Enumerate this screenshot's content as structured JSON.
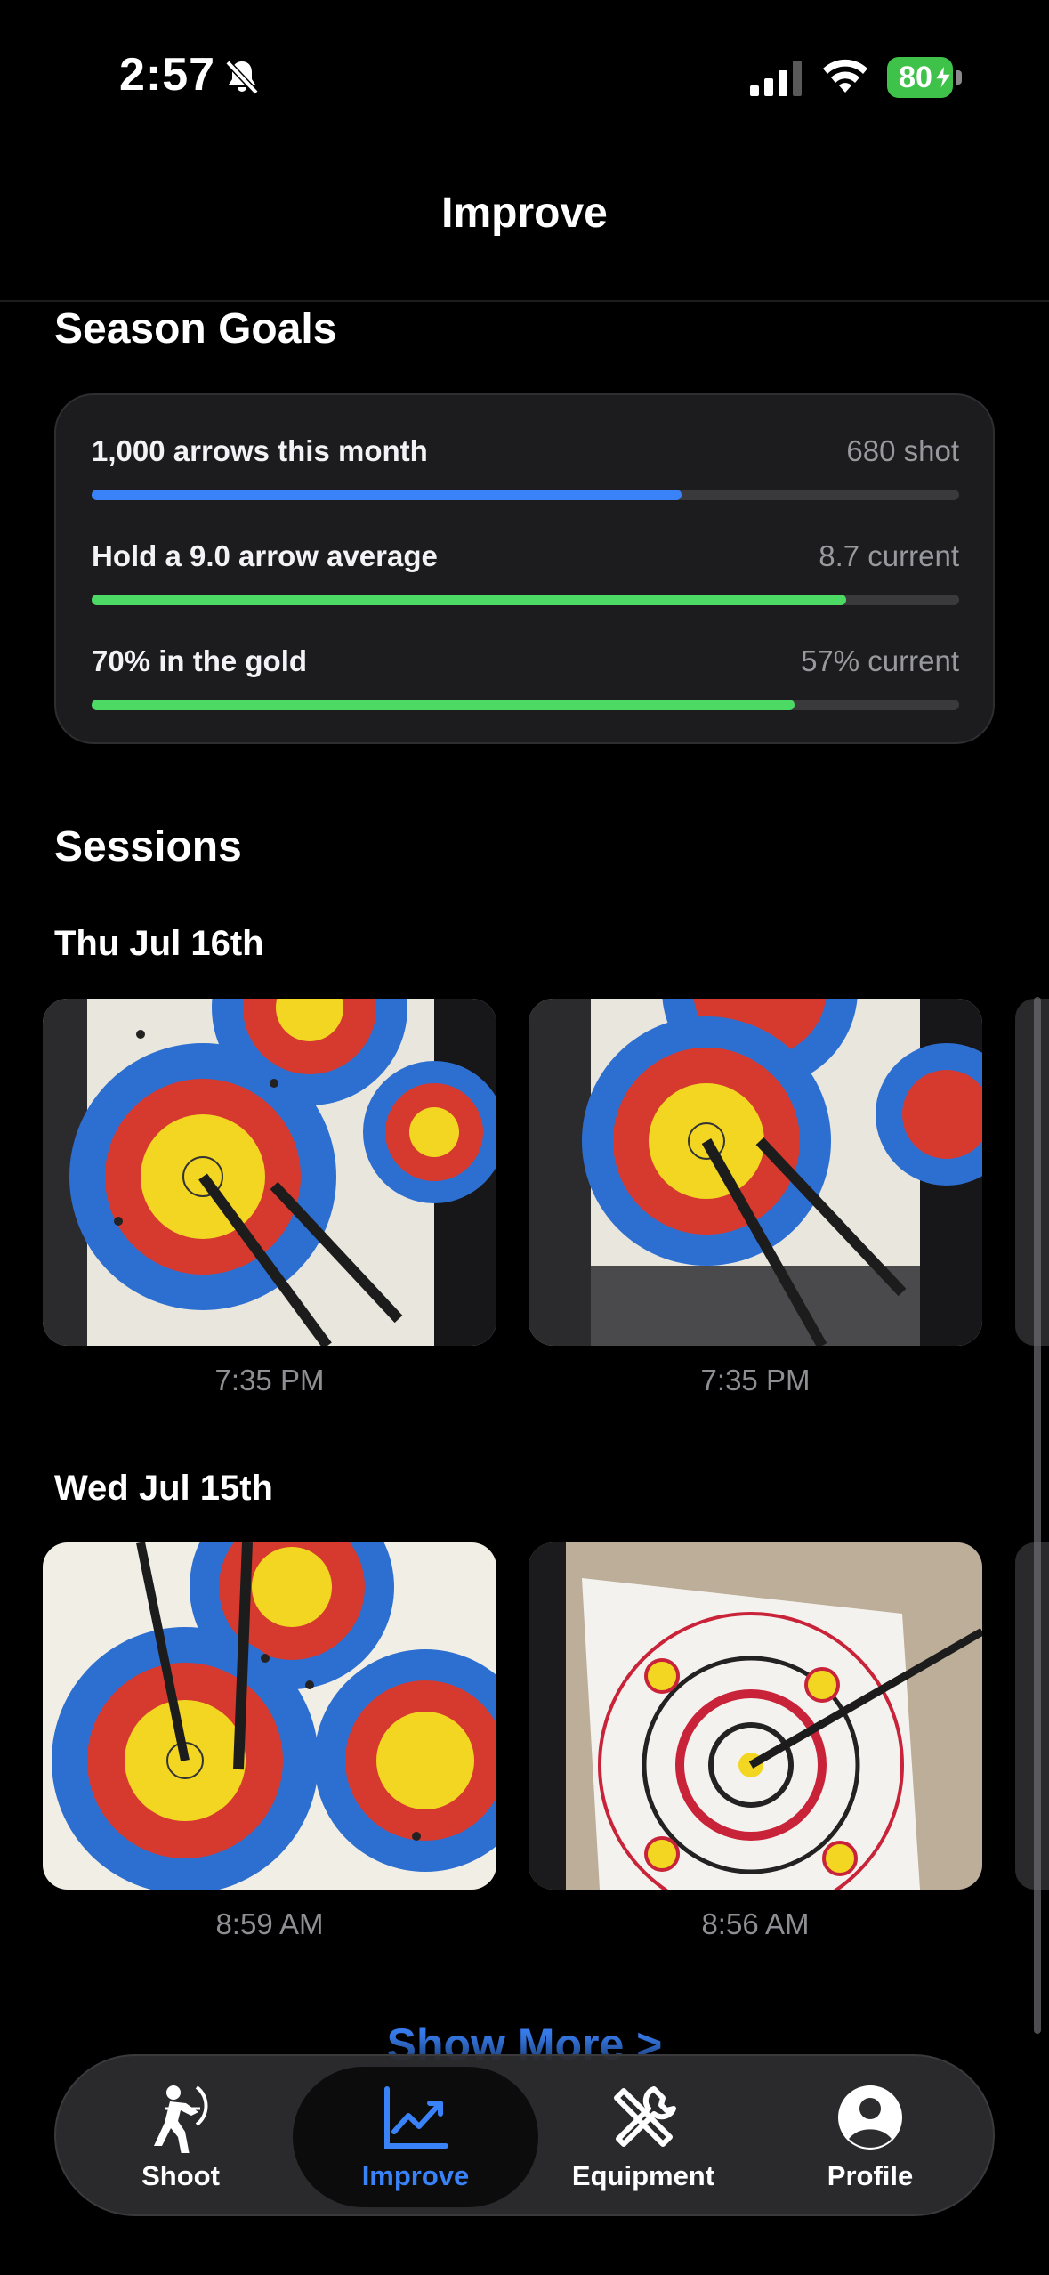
{
  "status_bar": {
    "time": "2:57",
    "battery": "80"
  },
  "nav": {
    "title": "Improve"
  },
  "goals": {
    "title": "Season Goals",
    "items": [
      {
        "label": "1,000 arrows this month",
        "value": "680 shot",
        "progress": 0.68,
        "color": "#3a82f7"
      },
      {
        "label": "Hold a 9.0 arrow average",
        "value": "8.7 current",
        "progress": 0.87,
        "color": "#4cd964"
      },
      {
        "label": "70% in the gold",
        "value": "57% current",
        "progress": 0.81,
        "color": "#4cd964"
      }
    ]
  },
  "sessions": {
    "title": "Sessions",
    "days": [
      {
        "date": "Thu Jul 16th",
        "photos": [
          {
            "time": "7:35 PM"
          },
          {
            "time": "7:35 PM"
          }
        ]
      },
      {
        "date": "Wed Jul 15th",
        "photos": [
          {
            "time": "8:59 AM"
          },
          {
            "time": "8:56 AM"
          }
        ]
      }
    ],
    "show_more": "Show More >"
  },
  "tabbar": {
    "active": "Improve",
    "items": [
      {
        "label": "Shoot",
        "icon": "archer-icon"
      },
      {
        "label": "Improve",
        "icon": "chart-icon"
      },
      {
        "label": "Equipment",
        "icon": "tools-icon"
      },
      {
        "label": "Profile",
        "icon": "person-icon"
      }
    ]
  },
  "colors": {
    "accent": "#3a82f7",
    "green": "#4cd964",
    "battery": "#3fc24a"
  }
}
